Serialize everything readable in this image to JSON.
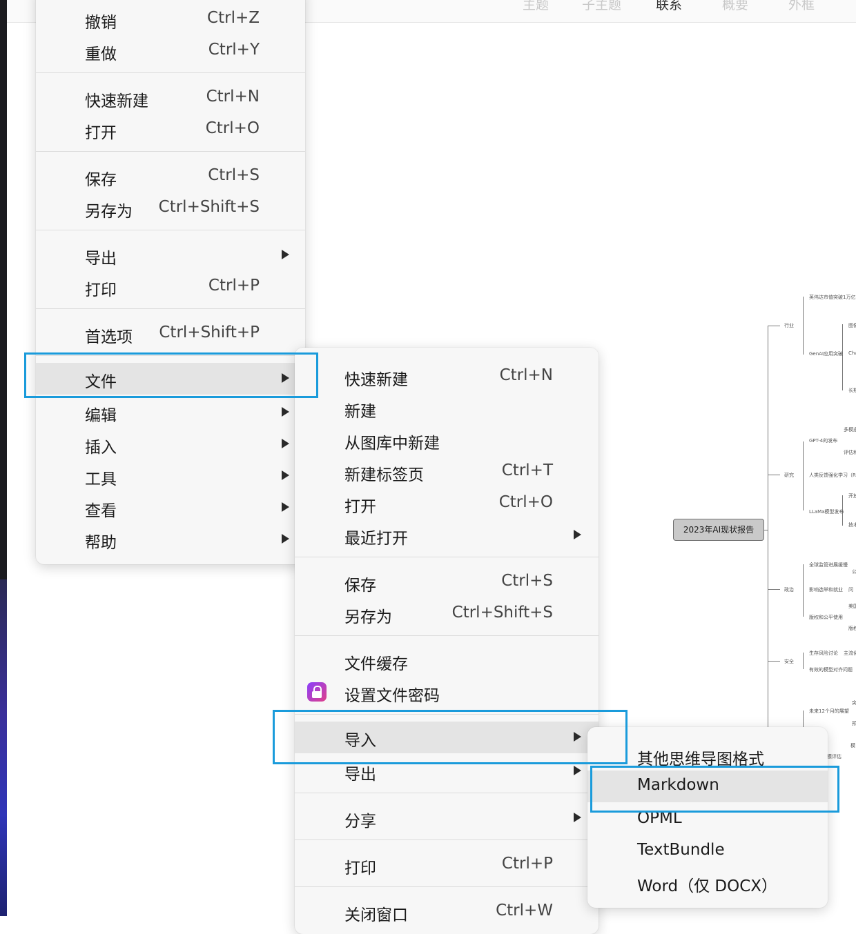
{
  "toolbar": {
    "tabs": [
      {
        "label": "主题"
      },
      {
        "label": "子主题"
      },
      {
        "label": "联系"
      },
      {
        "label": "概要"
      },
      {
        "label": "外框"
      }
    ]
  },
  "menu1": {
    "items": [
      {
        "label": "撤销",
        "shortcut": "Ctrl+Z"
      },
      {
        "label": "重做",
        "shortcut": "Ctrl+Y"
      },
      {
        "label": "快速新建",
        "shortcut": "Ctrl+N"
      },
      {
        "label": "打开",
        "shortcut": "Ctrl+O"
      },
      {
        "label": "保存",
        "shortcut": "Ctrl+S"
      },
      {
        "label": "另存为",
        "shortcut": "Ctrl+Shift+S"
      },
      {
        "label": "导出",
        "shortcut": ""
      },
      {
        "label": "打印",
        "shortcut": "Ctrl+P"
      },
      {
        "label": "首选项",
        "shortcut": "Ctrl+Shift+P"
      },
      {
        "label": "文件",
        "shortcut": ""
      },
      {
        "label": "编辑",
        "shortcut": ""
      },
      {
        "label": "插入",
        "shortcut": ""
      },
      {
        "label": "工具",
        "shortcut": ""
      },
      {
        "label": "查看",
        "shortcut": ""
      },
      {
        "label": "帮助",
        "shortcut": ""
      }
    ]
  },
  "menu2": {
    "items": [
      {
        "label": "快速新建",
        "shortcut": "Ctrl+N"
      },
      {
        "label": "新建",
        "shortcut": ""
      },
      {
        "label": "从图库中新建",
        "shortcut": ""
      },
      {
        "label": "新建标签页",
        "shortcut": "Ctrl+T"
      },
      {
        "label": "打开",
        "shortcut": "Ctrl+O"
      },
      {
        "label": "最近打开",
        "shortcut": ""
      },
      {
        "label": "保存",
        "shortcut": "Ctrl+S"
      },
      {
        "label": "另存为",
        "shortcut": "Ctrl+Shift+S"
      },
      {
        "label": "文件缓存",
        "shortcut": ""
      },
      {
        "label": "设置文件密码",
        "shortcut": ""
      },
      {
        "label": "导入",
        "shortcut": ""
      },
      {
        "label": "导出",
        "shortcut": ""
      },
      {
        "label": "分享",
        "shortcut": ""
      },
      {
        "label": "打印",
        "shortcut": "Ctrl+P"
      },
      {
        "label": "关闭窗口",
        "shortcut": "Ctrl+W"
      }
    ]
  },
  "menu3": {
    "items": [
      {
        "label": "其他思维导图格式"
      },
      {
        "label": "Markdown"
      },
      {
        "label": "OPML"
      },
      {
        "label": "TextBundle"
      },
      {
        "label": "Word（仅 DOCX）"
      }
    ]
  },
  "mindmap": {
    "root": "2023年AI现状报告",
    "branches": [
      "行业",
      "研究",
      "政治",
      "安全"
    ],
    "subtopics": [
      "英伟达市值突破1万亿美元",
      "GenAI应用突破",
      "GPT-4的发布",
      "人类反馈强化学习（RLHF）",
      "LLaMa模型发布",
      "全球监管进展缓慢",
      "影响选举和就业",
      "版权和公平使用",
      "生存风险讨论",
      "有效的模型对齐问题",
      "未来12个月的展望",
      "模评估"
    ],
    "leaves": [
      "图像",
      "Cha",
      "长期",
      "多模态",
      "评估和",
      "开放",
      "技术",
      "公",
      "问",
      "美国",
      "版权",
      "主流化",
      "突",
      "预",
      "模"
    ]
  }
}
